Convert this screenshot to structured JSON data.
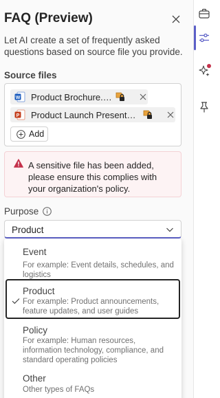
{
  "panel": {
    "title": "FAQ (Preview)",
    "description": "Let AI create a set of frequently asked questions based on source file you provide."
  },
  "source_files": {
    "label": "Source files",
    "files": [
      {
        "name": "Product Brochure.docx",
        "type": "word-file-icon"
      },
      {
        "name": "Product Launch Presentatio...",
        "type": "powerpoint-file-icon"
      }
    ],
    "add_label": "Add"
  },
  "warning": {
    "text": "A sensitive file has been added, please ensure this complies with your organization's policy."
  },
  "purpose": {
    "label": "Purpose",
    "selected_value": "Product",
    "options": [
      {
        "title": "Event",
        "description": "For example: Event details, schedules, and logistics"
      },
      {
        "title": "Product",
        "description": "For example: Product announcements, feature updates, and user guides"
      },
      {
        "title": "Policy",
        "description": "For example: Human resources, information technology, compliance, and standard operating policies"
      },
      {
        "title": "Other",
        "description": "Other types of FAQs"
      }
    ]
  },
  "rail": {
    "icons": [
      "briefcase-icon",
      "sliders-icon",
      "sparkle-icon",
      "pin-icon"
    ]
  },
  "colors": {
    "accent": "#5b5fc7",
    "warning_bg": "#fdf3f4",
    "warning_icon": "#c4314b",
    "word_blue": "#185abd",
    "ppt_orange": "#c43e1c"
  }
}
